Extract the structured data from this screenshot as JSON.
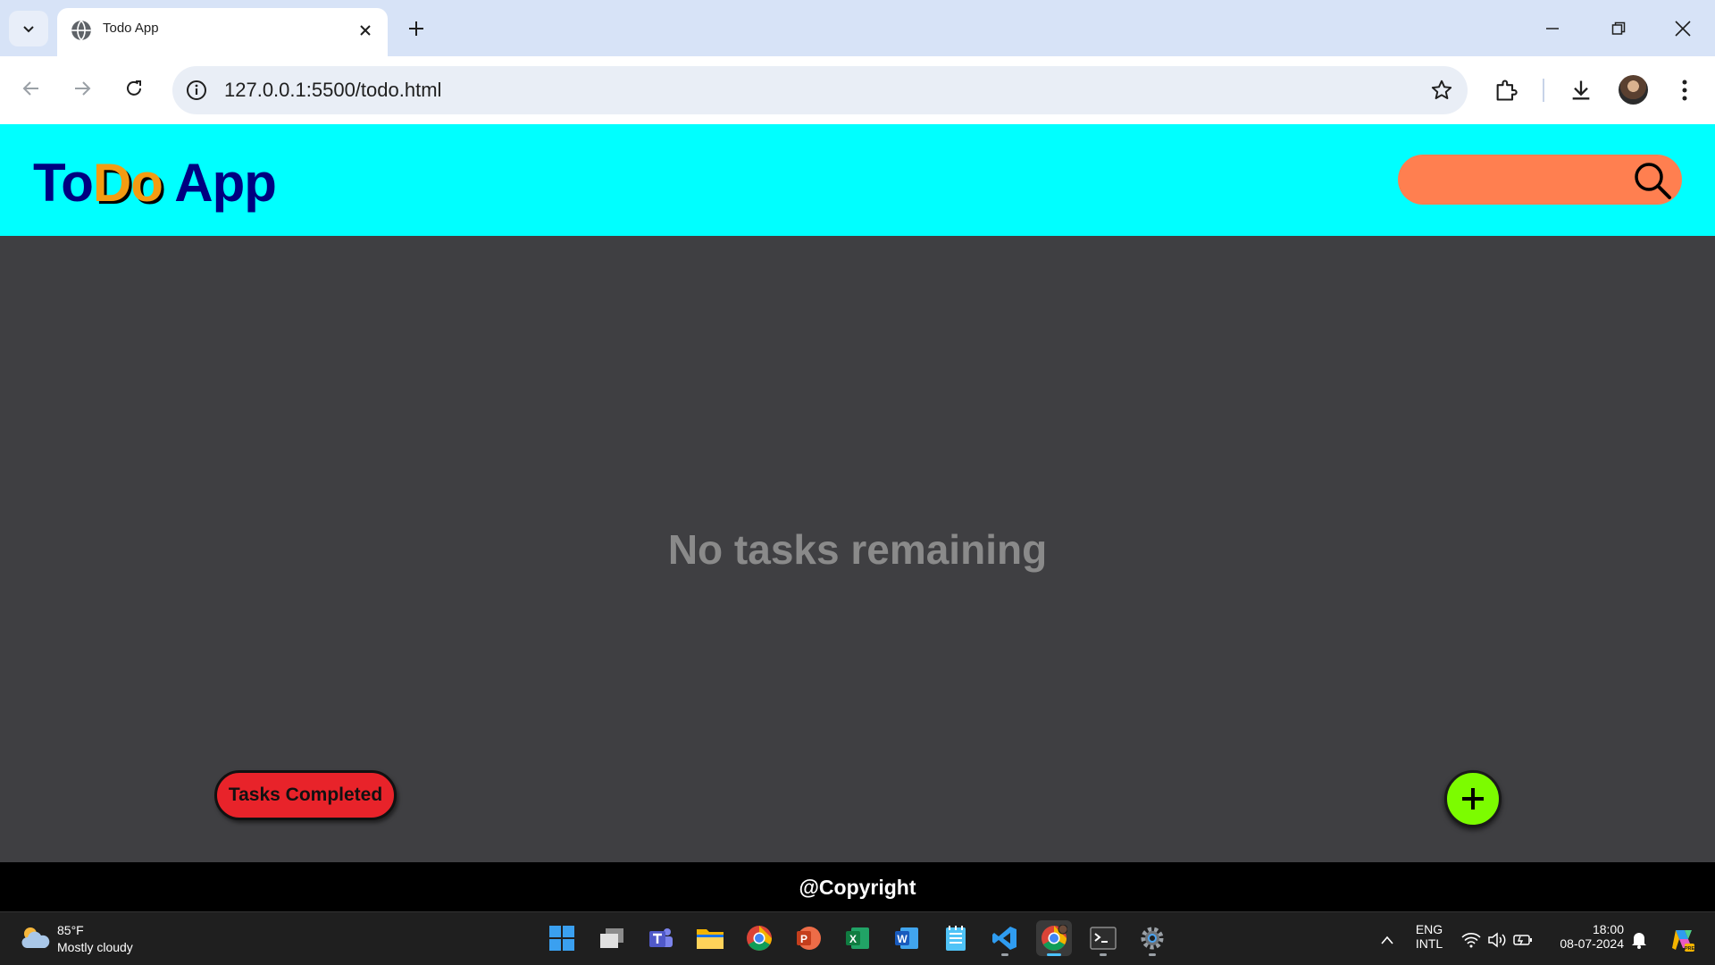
{
  "browser": {
    "tab_title": "Todo App",
    "url": "127.0.0.1:5500/todo.html"
  },
  "app": {
    "logo_part1": "To",
    "logo_accent": "Do",
    "logo_part2": " App",
    "search_placeholder": "",
    "empty_message": "No tasks remaining",
    "tasks_completed_label": "Tasks Completed",
    "add_label": "+",
    "footer_text": "@Copyright",
    "colors": {
      "header_bg": "#00ffff",
      "logo": "#000080",
      "logo_accent": "#f39c12",
      "search_bg": "#ff7f50",
      "main_bg": "#3f3f42",
      "tasks_completed_bg": "#e8232a",
      "add_button_bg": "#7cfc00",
      "footer_bg": "#000000"
    }
  },
  "taskbar": {
    "weather_temp": "85°F",
    "weather_condition": "Mostly cloudy",
    "language_line1": "ENG",
    "language_line2": "INTL",
    "time": "18:00",
    "date": "08-07-2024",
    "apps": [
      "start-icon",
      "task-view-icon",
      "teams-icon",
      "file-explorer-icon",
      "chrome-icon",
      "powerpoint-icon",
      "excel-icon",
      "word-icon",
      "notepad-icon",
      "vscode-icon",
      "chrome-profile-icon",
      "terminal-icon",
      "settings-icon"
    ]
  }
}
